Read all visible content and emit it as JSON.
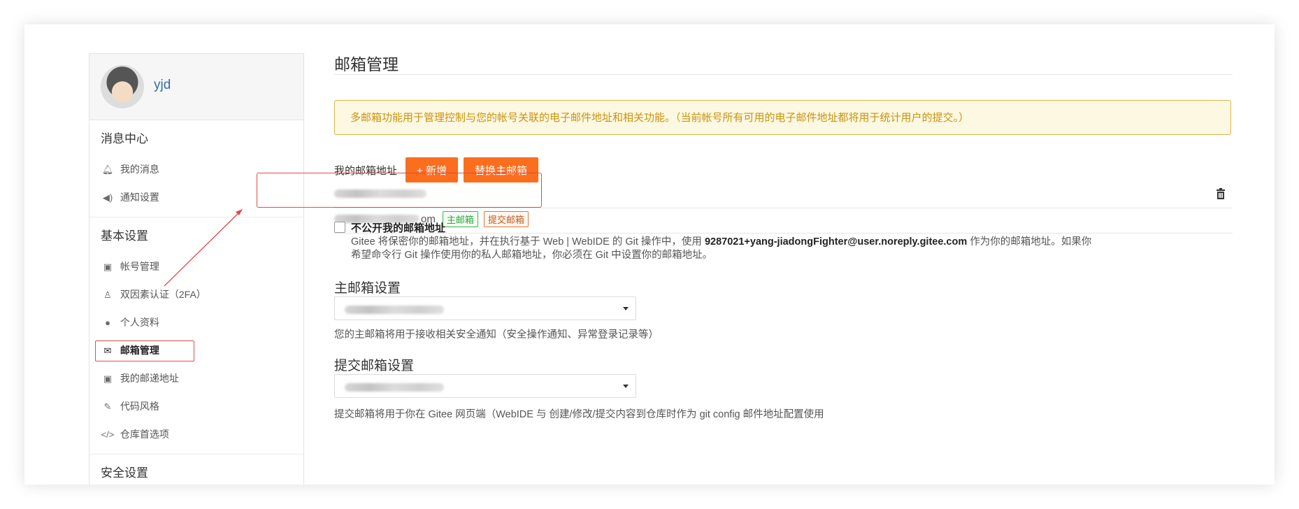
{
  "user": {
    "name": "yjd"
  },
  "sidebar": {
    "sections": [
      {
        "title": "消息中心",
        "items": [
          {
            "label": "我的消息",
            "icon": "bell-icon"
          },
          {
            "label": "通知设置",
            "icon": "volume-icon"
          }
        ]
      },
      {
        "title": "基本设置",
        "items": [
          {
            "label": "帐号管理",
            "icon": "id-card-icon"
          },
          {
            "label": "双因素认证（2FA）",
            "icon": "user-shield-icon"
          },
          {
            "label": "个人资料",
            "icon": "user-icon"
          },
          {
            "label": "邮箱管理",
            "icon": "envelope-icon",
            "active": true
          },
          {
            "label": "我的邮递地址",
            "icon": "address-card-icon"
          },
          {
            "label": "代码风格",
            "icon": "paint-brush-icon"
          },
          {
            "label": "仓库首选项",
            "icon": "code-icon"
          }
        ]
      },
      {
        "title": "安全设置",
        "items": []
      }
    ]
  },
  "main": {
    "title": "邮箱管理",
    "notice": "多邮箱功能用于管理控制与您的帐号关联的电子邮件地址和相关功能。（当前帐号所有可用的电子邮件地址都将用于统计用户的提交。）",
    "my_email_label": "我的邮箱地址",
    "add_button": "+ 新增",
    "replace_primary_button": "替换主邮箱",
    "emails": [
      {
        "address_suffix": "",
        "tags": []
      },
      {
        "address_suffix": "om",
        "tags": [
          "主邮箱",
          "提交邮箱"
        ]
      }
    ],
    "privacy": {
      "title": "不公开我的邮箱地址",
      "desc_before": "Gitee 将保密你的邮箱地址，并在执行基于 Web | WebIDE 的 Git 操作中，使用 ",
      "noreply": "9287021+yang-jiadongFighter@user.noreply.gitee.com",
      "desc_after": " 作为你的邮箱地址。如果你希望命令行 Git 操作使用你的私人邮箱地址，你必须在 Git 中设置你的邮箱地址。"
    },
    "primary": {
      "title": "主邮箱设置",
      "hint": "您的主邮箱将用于接收相关安全通知（安全操作通知、异常登录记录等）"
    },
    "commit": {
      "title": "提交邮箱设置",
      "hint": "提交邮箱将用于你在 Gitee 网页端（WebIDE 与 创建/修改/提交内容到仓库时作为 git config 邮件地址配置使用"
    }
  },
  "colors": {
    "accent_orange": "#fa6e1e",
    "annotation_red": "#e04a4a",
    "notice_border": "#d9b64b",
    "notice_text": "#c9930f"
  }
}
